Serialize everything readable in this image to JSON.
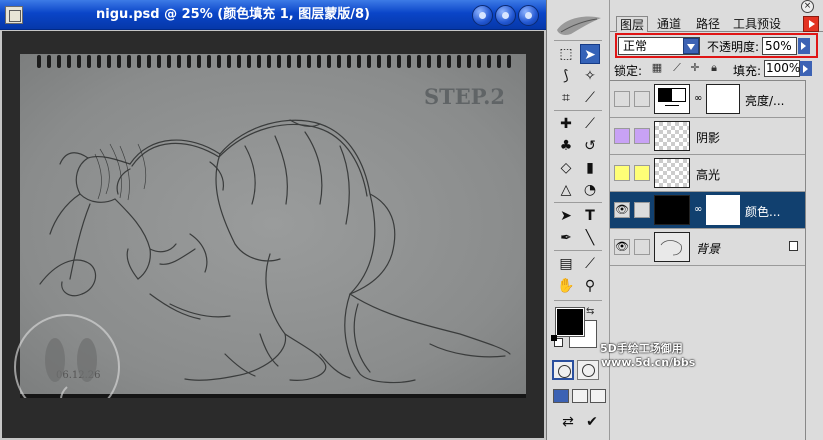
{
  "window": {
    "title": "nigu.psd @ 25% (颜色填充 1, 图层蒙版/8)"
  },
  "canvas": {
    "step_label": "STEP.2",
    "date_label": "06.12.26"
  },
  "toolbox": {
    "tools": [
      "marquee-tool",
      "move-tool",
      "lasso-tool",
      "magic-wand-tool",
      "crop-tool",
      "slice-tool",
      "healing-brush-tool",
      "brush-tool",
      "clone-stamp-tool",
      "history-brush-tool",
      "eraser-tool",
      "gradient-tool",
      "blur-tool",
      "dodge-tool",
      "path-selection-tool",
      "type-tool",
      "pen-tool",
      "line-tool",
      "notes-tool",
      "eyedropper-tool",
      "hand-tool",
      "zoom-tool"
    ],
    "foreground_color": "#000000",
    "background_color": "#ffffff"
  },
  "palette": {
    "tabs": [
      "图层",
      "通道",
      "路径",
      "工具预设"
    ],
    "blend_mode": "正常",
    "opacity_label": "不透明度:",
    "opacity_value": "50%",
    "lock_label": "锁定:",
    "fill_label": "填充:",
    "fill_value": "100%",
    "layers": [
      {
        "name": "亮度/...",
        "visible": false,
        "selected": false
      },
      {
        "name": "阴影",
        "visible": false,
        "selected": false,
        "color": "#c8a2f5"
      },
      {
        "name": "高光",
        "visible": false,
        "selected": false,
        "color": "#ffff77"
      },
      {
        "name": "颜色...",
        "visible": true,
        "selected": true
      },
      {
        "name": "背景",
        "visible": true,
        "selected": false
      }
    ]
  },
  "watermark": {
    "line1": "5D手绘工场御用",
    "line2": "www.5d.cn/bbs"
  }
}
